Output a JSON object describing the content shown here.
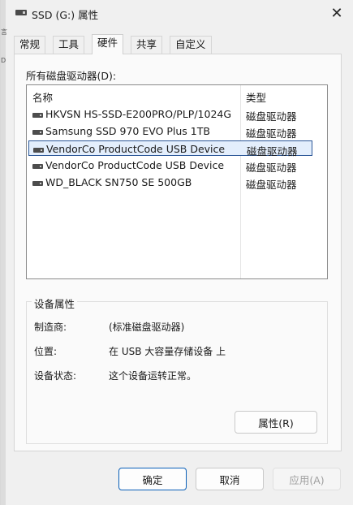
{
  "window": {
    "title": "SSD (G:) 属性",
    "close_glyph": "✕",
    "edge_chars": [
      "言",
      "D"
    ]
  },
  "tabs": [
    {
      "label": "常规",
      "active": false
    },
    {
      "label": "工具",
      "active": false
    },
    {
      "label": "硬件",
      "active": true
    },
    {
      "label": "共享",
      "active": false
    },
    {
      "label": "自定义",
      "active": false
    }
  ],
  "drives_section": {
    "label": "所有磁盘驱动器(D):",
    "columns": {
      "name": "名称",
      "type": "类型"
    },
    "rows": [
      {
        "name": "HKVSN HS-SSD-E200PRO/PLP/1024G",
        "type": "磁盘驱动器",
        "icon": "drive-icon",
        "selected": false
      },
      {
        "name": "Samsung SSD 970 EVO Plus 1TB",
        "type": "磁盘驱动器",
        "icon": "drive-icon",
        "selected": false
      },
      {
        "name": "VendorCo ProductCode USB Device",
        "type": "磁盘驱动器",
        "icon": "drive-icon",
        "selected": true
      },
      {
        "name": "VendorCo ProductCode USB Device",
        "type": "磁盘驱动器",
        "icon": "drive-icon",
        "selected": false
      },
      {
        "name": "WD_BLACK SN750 SE 500GB",
        "type": "磁盘驱动器",
        "icon": "drive-icon",
        "selected": false
      }
    ]
  },
  "device_properties": {
    "legend": "设备属性",
    "manufacturer_label": "制造商:",
    "manufacturer_value": "(标准磁盘驱动器)",
    "location_label": "位置:",
    "location_value": "在 USB 大容量存储设备 上",
    "status_label": "设备状态:",
    "status_value": "这个设备运转正常。",
    "properties_button": "属性(R)"
  },
  "footer": {
    "ok": "确定",
    "cancel": "取消",
    "apply": "应用(A)"
  },
  "colors": {
    "selection_bg": "#e3eefc",
    "selection_border": "#2b5797",
    "primary_border": "#0a5fb8"
  }
}
